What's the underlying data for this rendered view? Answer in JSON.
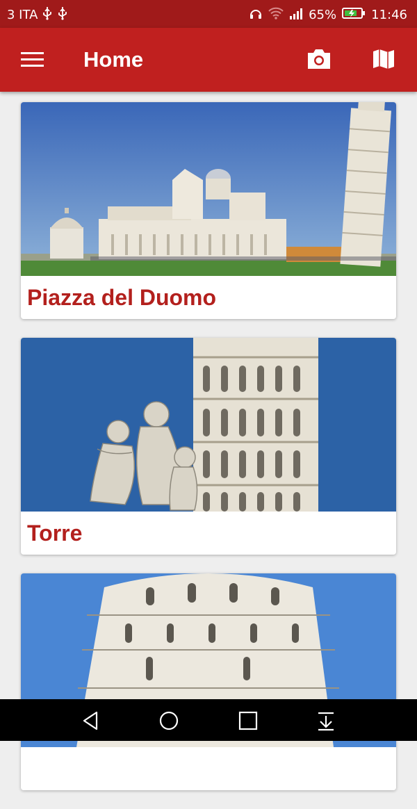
{
  "status_bar": {
    "carrier": "3 ITA",
    "battery_percent": "65%",
    "time": "11:46",
    "icons": [
      "usb-icon",
      "usb-icon",
      "headphones-icon",
      "wifi-icon",
      "signal-icon",
      "battery-charging-icon"
    ]
  },
  "app_bar": {
    "title": "Home",
    "icons": [
      "menu-icon",
      "camera-icon",
      "map-icon"
    ],
    "color": "#c0201f"
  },
  "cards": [
    {
      "title": "Piazza del Duomo"
    },
    {
      "title": "Torre"
    },
    {
      "title": ""
    }
  ],
  "nav_bar": {
    "icons": [
      "back-icon",
      "home-icon",
      "recents-icon",
      "notifications-pull-icon"
    ]
  },
  "colors": {
    "accent": "#c0201f",
    "title_text": "#b3201d",
    "status_bar": "#a01a1a"
  }
}
